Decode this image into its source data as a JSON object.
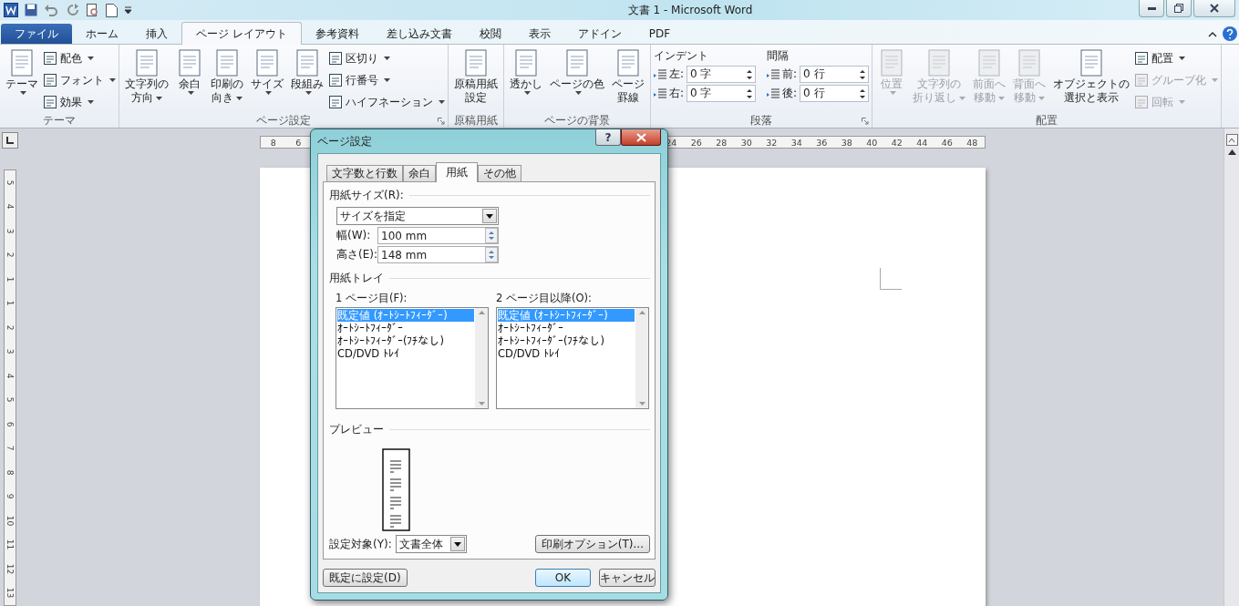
{
  "title_bar": {
    "title": "文書 1 - Microsoft Word"
  },
  "ribbon_tabs": [
    {
      "label": "ファイル",
      "kind": "file",
      "selected": false
    },
    {
      "label": "ホーム",
      "kind": "tab",
      "selected": false
    },
    {
      "label": "挿入",
      "kind": "tab",
      "selected": false
    },
    {
      "label": "ページ レイアウト",
      "kind": "tab",
      "selected": true
    },
    {
      "label": "参考資料",
      "kind": "tab",
      "selected": false
    },
    {
      "label": "差し込み文書",
      "kind": "tab",
      "selected": false
    },
    {
      "label": "校閲",
      "kind": "tab",
      "selected": false
    },
    {
      "label": "表示",
      "kind": "tab",
      "selected": false
    },
    {
      "label": "アドイン",
      "kind": "tab",
      "selected": false
    },
    {
      "label": "PDF",
      "kind": "tab",
      "selected": false
    }
  ],
  "ribbon_groups": [
    {
      "kind": "buttons",
      "title": "テーマ",
      "launcher": false,
      "big": [
        {
          "lines": [
            "テーマ"
          ],
          "dropdown": true,
          "disabled": false
        }
      ],
      "small": [
        {
          "label": "配色",
          "dropdown": true,
          "disabled": false
        },
        {
          "label": "フォント",
          "dropdown": true,
          "disabled": false
        },
        {
          "label": "効果",
          "dropdown": true,
          "disabled": false
        }
      ]
    },
    {
      "kind": "buttons",
      "title": "ページ設定",
      "launcher": true,
      "big": [
        {
          "lines": [
            "文字列の",
            "方向"
          ],
          "dropdown": true,
          "disabled": false
        },
        {
          "lines": [
            "余白"
          ],
          "dropdown": true,
          "disabled": false
        },
        {
          "lines": [
            "印刷の",
            "向き"
          ],
          "dropdown": true,
          "disabled": false
        },
        {
          "lines": [
            "サイズ"
          ],
          "dropdown": true,
          "disabled": false
        },
        {
          "lines": [
            "段組み"
          ],
          "dropdown": true,
          "disabled": false
        }
      ],
      "small": [
        {
          "label": "区切り",
          "dropdown": true,
          "disabled": false
        },
        {
          "label": "行番号",
          "dropdown": true,
          "disabled": false
        },
        {
          "label": "ハイフネーション",
          "dropdown": true,
          "disabled": false
        }
      ]
    },
    {
      "kind": "buttons",
      "title": "原稿用紙",
      "launcher": false,
      "big": [
        {
          "lines": [
            "原稿用紙",
            "設定"
          ],
          "dropdown": false,
          "disabled": false
        }
      ]
    },
    {
      "kind": "buttons",
      "title": "ページの背景",
      "launcher": false,
      "big": [
        {
          "lines": [
            "透かし"
          ],
          "dropdown": true,
          "disabled": false
        },
        {
          "lines": [
            "ページの色"
          ],
          "dropdown": true,
          "disabled": false
        },
        {
          "lines": [
            "ページ",
            "罫線"
          ],
          "dropdown": false,
          "disabled": false
        }
      ]
    },
    {
      "kind": "paragraph",
      "title": "段落",
      "launcher": true,
      "sections": [
        {
          "title": "インデント",
          "fields": [
            {
              "label": "左:",
              "value": "0 字"
            },
            {
              "label": "右:",
              "value": "0 字"
            }
          ]
        },
        {
          "title": "間隔",
          "fields": [
            {
              "label": "前:",
              "value": "0 行"
            },
            {
              "label": "後:",
              "value": "0 行"
            }
          ]
        }
      ]
    },
    {
      "kind": "buttons",
      "title": "配置",
      "launcher": false,
      "big": [
        {
          "lines": [
            "位置"
          ],
          "dropdown": true,
          "disabled": true
        },
        {
          "lines": [
            "文字列の",
            "折り返し"
          ],
          "dropdown": true,
          "disabled": true
        },
        {
          "lines": [
            "前面へ",
            "移動"
          ],
          "dropdown": true,
          "disabled": true
        },
        {
          "lines": [
            "背面へ",
            "移動"
          ],
          "dropdown": true,
          "disabled": true
        },
        {
          "lines": [
            "オブジェクトの",
            "選択と表示"
          ],
          "dropdown": false,
          "disabled": false
        }
      ],
      "small": [
        {
          "label": "配置",
          "dropdown": true,
          "disabled": false
        },
        {
          "label": "グループ化",
          "dropdown": true,
          "disabled": true
        },
        {
          "label": "回転",
          "dropdown": true,
          "disabled": true
        }
      ]
    }
  ],
  "ruler": {
    "left_labels": [
      "8",
      "6"
    ],
    "right_labels": [
      "24",
      "26",
      "28",
      "30",
      "32",
      "34",
      "36",
      "38",
      "40",
      "42",
      "44",
      "46",
      "48"
    ]
  },
  "vertical_ruler": [
    "5",
    "4",
    "3",
    "2",
    "1",
    "1",
    "2",
    "3",
    "4",
    "5",
    "6",
    "7",
    "8",
    "9",
    "10",
    "11",
    "12",
    "13"
  ],
  "dialog": {
    "title": "ページ設定",
    "help_label": "?",
    "tabs": [
      {
        "label": "文字数と行数",
        "selected": false
      },
      {
        "label": "余白",
        "selected": false
      },
      {
        "label": "用紙",
        "selected": true
      },
      {
        "label": "その他",
        "selected": false
      }
    ],
    "paper_size": {
      "heading": "用紙サイズ(R):",
      "select": "サイズを指定",
      "width_label": "幅(W):",
      "width": "100 mm",
      "height_label": "高さ(E):",
      "height": "148 mm"
    },
    "paper_tray": {
      "heading": "用紙トレイ",
      "lists": [
        {
          "label": "1 ページ目(F):",
          "items": [
            {
              "text": "既定値 (ｵｰﾄｼｰﾄﾌｨｰﾀﾞｰ)",
              "selected": true
            },
            {
              "text": "ｵｰﾄｼｰﾄﾌｨｰﾀﾞｰ",
              "selected": false
            },
            {
              "text": "ｵｰﾄｼｰﾄﾌｨｰﾀﾞｰ(ﾌﾁなし)",
              "selected": false
            },
            {
              "text": "CD/DVD ﾄﾚｲ",
              "selected": false
            }
          ]
        },
        {
          "label": "2 ページ目以降(O):",
          "items": [
            {
              "text": "既定値 (ｵｰﾄｼｰﾄﾌｨｰﾀﾞｰ)",
              "selected": true
            },
            {
              "text": "ｵｰﾄｼｰﾄﾌｨｰﾀﾞｰ",
              "selected": false
            },
            {
              "text": "ｵｰﾄｼｰﾄﾌｨｰﾀﾞｰ(ﾌﾁなし)",
              "selected": false
            },
            {
              "text": "CD/DVD ﾄﾚｲ",
              "selected": false
            }
          ]
        }
      ]
    },
    "preview": {
      "heading": "プレビュー"
    },
    "apply_to": {
      "label": "設定対象(Y):",
      "value": "文書全体"
    },
    "print_options": "印刷オプション(T)...",
    "buttons": [
      {
        "label": "既定に設定(D)",
        "kind": "default"
      },
      {
        "label": "OK",
        "kind": "ok"
      },
      {
        "label": "キャンセル",
        "kind": "cancel"
      }
    ]
  }
}
